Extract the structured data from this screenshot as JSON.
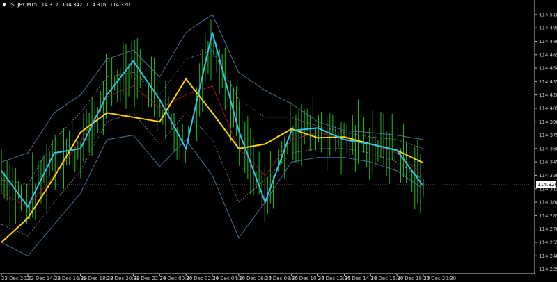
{
  "header": {
    "symbol": "USDJPY,M15",
    "values": [
      "114.317",
      "114.342",
      "114.316",
      "114.320"
    ],
    "menu_icon": "triangle-down-icon"
  },
  "colors": {
    "background": "#000000",
    "axis": "#c8c8c8",
    "candles": "#1fbf1f",
    "ma_fast": "#2fc3f0",
    "ma_slow": "#ffd400",
    "ma_mid": "#a01818",
    "band_outer": "#4a6f96",
    "band_inner": "#8c8c8c",
    "price_tag_bg": "#ffffff"
  },
  "chart_data": {
    "type": "line",
    "title": "USDJPY,M15",
    "ylim": [
      114.22,
      114.52
    ],
    "yticks": [
      "114.510",
      "114.495",
      "114.480",
      "114.465",
      "114.450",
      "114.435",
      "114.420",
      "114.405",
      "114.390",
      "114.375",
      "114.360",
      "114.345",
      "114.330",
      "114.315",
      "114.300",
      "114.285",
      "114.270",
      "114.255",
      "114.240",
      "114.225"
    ],
    "xticks": [
      "23 Dec 2021",
      "23 Dec 14:30",
      "23 Dec 16:30",
      "23 Dec 18:30",
      "23 Dec 20:30",
      "23 Dec 22:30",
      "24 Dec 00:30",
      "24 Dec 02:30",
      "24 Dec 04:30",
      "24 Dec 06:30",
      "24 Dec 08:30",
      "24 Dec 10:30",
      "24 Dec 12:30",
      "24 Dec 14:30",
      "24 Dec 16:30",
      "24 Dec 18:30",
      "24 Dec 20:30"
    ],
    "current_price": "114.320",
    "x": [
      0,
      4,
      8,
      12,
      16,
      20,
      24,
      28,
      32,
      36,
      40,
      44,
      48,
      52,
      56,
      60,
      64
    ],
    "series": [
      {
        "kind": "ma_fast",
        "values": [
          114.335,
          114.295,
          114.355,
          114.36,
          114.42,
          114.458,
          114.415,
          114.36,
          114.49,
          114.38,
          114.3,
          114.38,
          114.383,
          114.37,
          114.365,
          114.358,
          114.318
        ]
      },
      {
        "kind": "ma_slow",
        "values": [
          114.255,
          114.282,
          114.328,
          114.378,
          114.4,
          114.395,
          114.39,
          114.438,
          114.4,
          114.36,
          114.365,
          114.382,
          114.372,
          114.373,
          114.365,
          114.358,
          114.344
        ]
      },
      {
        "kind": "ma_mid",
        "values": [
          114.31,
          114.295,
          114.33,
          114.368,
          114.418,
          114.43,
          114.405,
          114.42,
          114.43,
          114.36,
          114.33,
          114.37,
          114.378,
          114.372,
          114.365,
          114.355,
          114.33
        ]
      },
      {
        "kind": "band_upper",
        "values": [
          114.345,
          114.355,
          114.4,
          114.42,
          114.46,
          114.47,
          114.44,
          114.49,
          114.51,
          114.445,
          114.425,
          114.41,
          114.39,
          114.38,
          114.378,
          114.375,
          114.37
        ]
      },
      {
        "kind": "band_lower",
        "values": [
          114.255,
          114.24,
          114.275,
          114.31,
          114.37,
          114.375,
          114.34,
          114.37,
          114.33,
          114.26,
          114.3,
          114.345,
          114.35,
          114.35,
          114.345,
          114.335,
          114.315
        ]
      },
      {
        "kind": "band_inner_upper",
        "values": [
          114.325,
          114.32,
          114.37,
          114.4,
          114.44,
          114.445,
          114.42,
          114.46,
          114.47,
          114.415,
          114.395,
          114.395,
          114.385,
          114.378,
          114.373,
          114.37,
          114.36
        ]
      },
      {
        "kind": "band_inner_lower",
        "values": [
          114.275,
          114.262,
          114.3,
          114.335,
          114.39,
          114.4,
          114.365,
          114.4,
          114.37,
          114.3,
          114.325,
          114.355,
          114.36,
          114.36,
          114.355,
          114.345,
          114.325
        ]
      }
    ]
  }
}
